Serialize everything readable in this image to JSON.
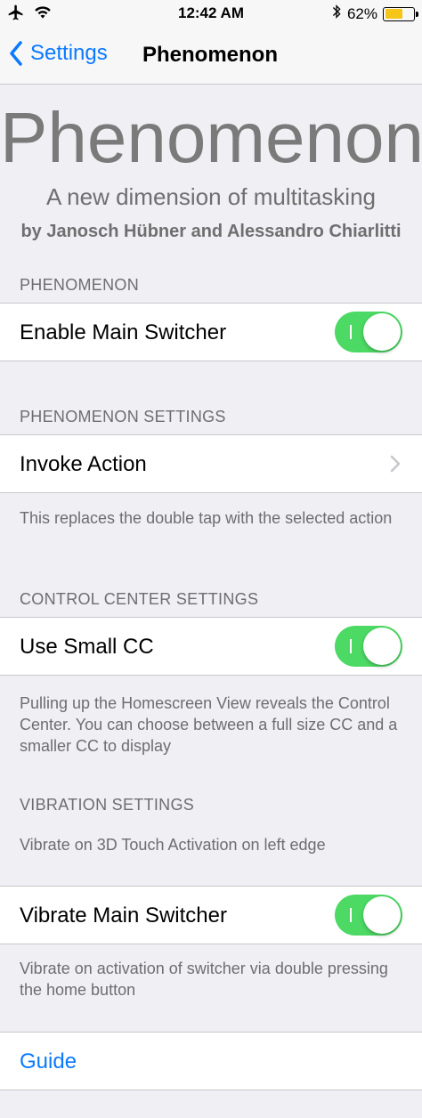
{
  "status_bar": {
    "time": "12:42 AM",
    "battery_percent": "62%",
    "battery_level": 0.62
  },
  "nav": {
    "back_label": "Settings",
    "title": "Phenomenon"
  },
  "header": {
    "title": "Phenomenon",
    "subtitle": "A new dimension of multitasking",
    "credit": "by Janosch Hübner and Alessandro Chiarlitti"
  },
  "sections": {
    "phenomenon": {
      "header": "PHENOMENON",
      "enable_main_switcher": {
        "label": "Enable Main Switcher",
        "on": true
      }
    },
    "phenomenon_settings": {
      "header": "PHENOMENON SETTINGS",
      "invoke_action": {
        "label": "Invoke Action"
      },
      "footer": "This replaces the double tap with the selected action"
    },
    "control_center": {
      "header": "CONTROL CENTER SETTINGS",
      "use_small_cc": {
        "label": "Use Small CC",
        "on": true
      },
      "footer": "Pulling up the Homescreen View reveals the Control Center. You can choose between a full size CC and a smaller CC to display"
    },
    "vibration": {
      "header": "VIBRATION SETTINGS",
      "subheader": "Vibrate on 3D Touch Activation on left edge",
      "vibrate_main_switcher": {
        "label": "Vibrate Main Switcher",
        "on": true
      },
      "footer": "Vibrate on activation of switcher via double pressing the home button"
    },
    "guide": {
      "label": "Guide"
    }
  },
  "colors": {
    "accent": "#0a7aff",
    "toggle_on": "#4cd964",
    "background": "#efeff4",
    "battery": "#f5c518"
  }
}
